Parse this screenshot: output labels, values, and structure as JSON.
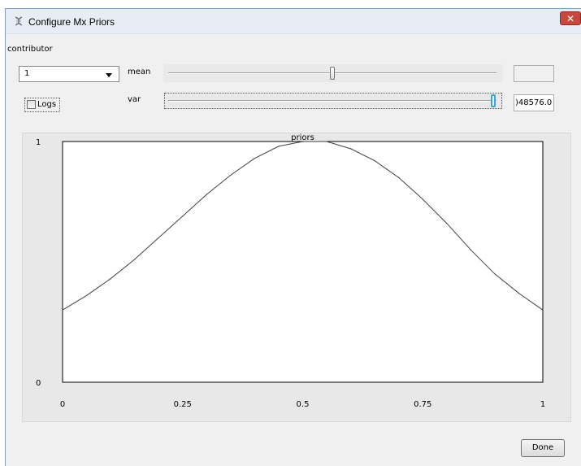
{
  "window": {
    "title": "Configure Mx Priors",
    "close_icon": "close-x-icon",
    "app_icon": "dna-helix-icon"
  },
  "controls": {
    "contributor_label": "contributor",
    "contributor_value": "1",
    "logs_label": "Logs",
    "logs_checked": false,
    "mean_label": "mean",
    "mean_value": "",
    "mean_slider_fraction": 0.5,
    "var_label": "var",
    "var_value": ")48576.0",
    "var_slider_fraction": 1.0
  },
  "chart_data": {
    "type": "line",
    "title": "priors",
    "xlabel": "",
    "ylabel": "",
    "xlim": [
      0,
      1
    ],
    "ylim": [
      0,
      1
    ],
    "x_ticks": [
      "0",
      "0.25",
      "0.5",
      "0.75",
      "1"
    ],
    "y_ticks": [
      "0",
      "1"
    ],
    "grid": false,
    "series": [
      {
        "color": "#404040",
        "x": [
          0,
          0.05,
          0.1,
          0.15,
          0.2,
          0.25,
          0.3,
          0.35,
          0.4,
          0.45,
          0.5,
          0.55,
          0.6,
          0.65,
          0.7,
          0.75,
          0.8,
          0.85,
          0.9,
          0.95,
          1.0
        ],
        "y": [
          0.3,
          0.36,
          0.43,
          0.51,
          0.6,
          0.69,
          0.78,
          0.86,
          0.93,
          0.98,
          1.0,
          1.0,
          0.97,
          0.92,
          0.85,
          0.76,
          0.66,
          0.55,
          0.45,
          0.37,
          0.3
        ]
      }
    ]
  },
  "footer": {
    "done_label": "Done"
  }
}
